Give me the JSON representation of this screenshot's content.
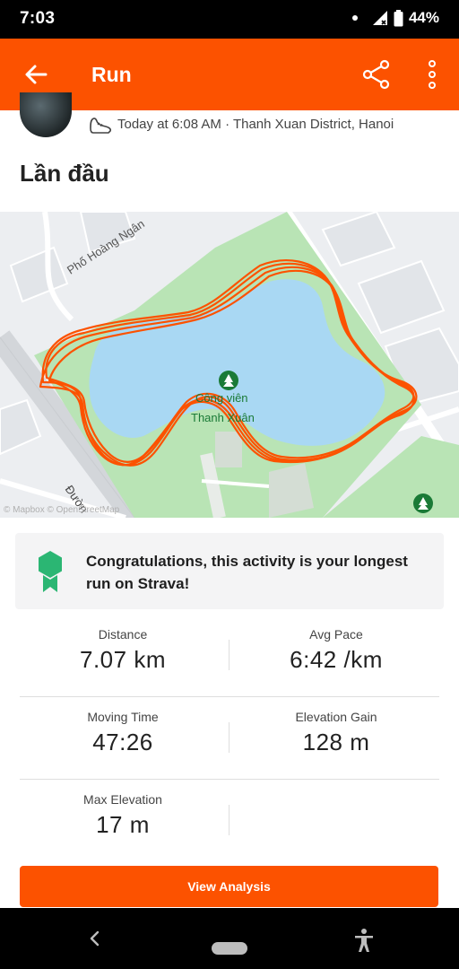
{
  "status_bar": {
    "time": "7:03",
    "battery": "44%"
  },
  "toolbar": {
    "title": "Run",
    "back_icon": "arrow-left-icon",
    "share_icon": "share-icon",
    "more_icon": "more-vertical-icon"
  },
  "activity": {
    "meta": "Today at 6:08 AM · Thanh Xuan District, Hanoi",
    "name": "Lần đầu"
  },
  "map": {
    "street_label_1": "Phố Hoàng Ngân",
    "street_label_2": "Đườn",
    "park_label_1": "Công viên",
    "park_label_2": "Thanh Xuân",
    "attribution": "© Mapbox © OpenStreetMap",
    "route_color": "#fc5200",
    "park_color": "#b6e3b6",
    "water_color": "#a8d7f2"
  },
  "congrats": {
    "text": "Congratulations, this activity is your longest run on Strava!",
    "icon": "achievement-badge-icon"
  },
  "stats": [
    {
      "label": "Distance",
      "value": "7.07 km"
    },
    {
      "label": "Avg Pace",
      "value": "6:42 /km"
    },
    {
      "label": "Moving Time",
      "value": "47:26"
    },
    {
      "label": "Elevation Gain",
      "value": "128 m"
    },
    {
      "label": "Max Elevation",
      "value": "17 m"
    }
  ],
  "view_analysis_label": "View Analysis",
  "colors": {
    "accent": "#fc5200"
  }
}
